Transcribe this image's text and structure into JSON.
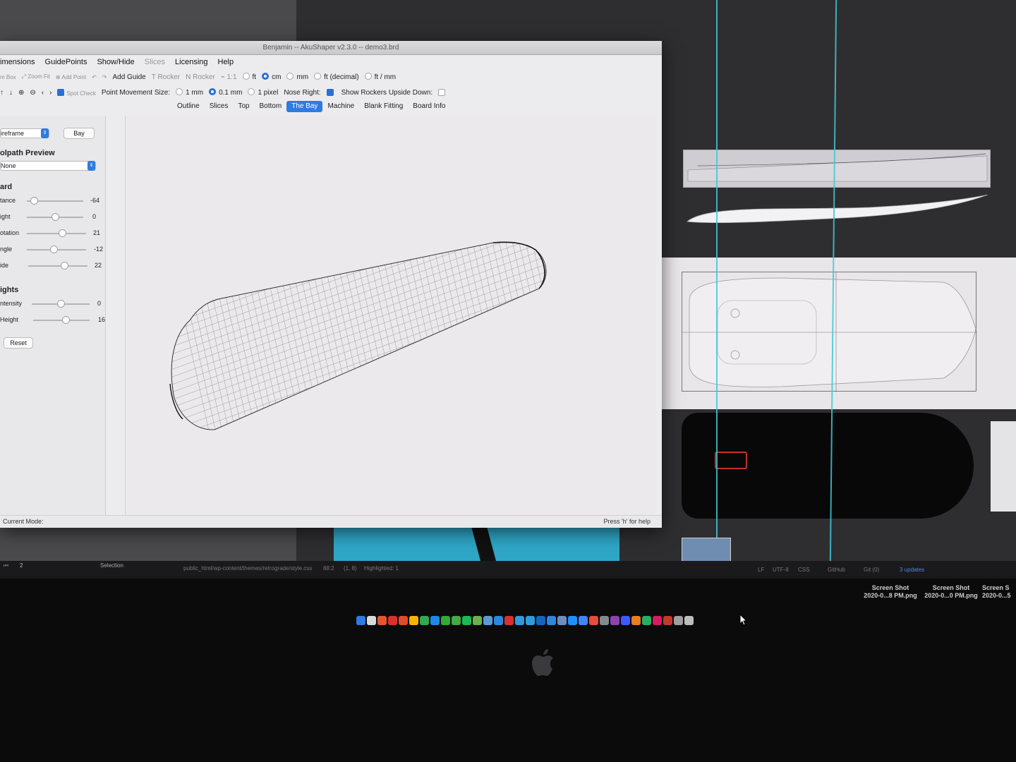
{
  "window": {
    "title": "Benjamin -- AkuShaper v2.3.0  --  demo3.brd"
  },
  "menu": [
    {
      "label": "imensions",
      "disabled": false
    },
    {
      "label": "GuidePoints",
      "disabled": false
    },
    {
      "label": "Show/Hide",
      "disabled": false
    },
    {
      "label": "Slices",
      "disabled": true
    },
    {
      "label": "Licensing",
      "disabled": false
    },
    {
      "label": "Help",
      "disabled": false
    }
  ],
  "toolbar1": {
    "zoom_box": "m Box",
    "zoom_fit": "Zoom Fit",
    "add_point": "Add Point",
    "add_guide": "Add Guide",
    "t_rocker": "T Rocker",
    "n_rocker": "N Rocker",
    "scale": "1:1",
    "units": [
      {
        "label": "ft",
        "selected": false
      },
      {
        "label": "cm",
        "selected": true
      },
      {
        "label": "mm",
        "selected": false
      },
      {
        "label": "ft (decimal)",
        "selected": false
      },
      {
        "label": "ft / mm",
        "selected": false
      }
    ]
  },
  "toolbar2": {
    "spot_check": "Spot Check",
    "spot_check_on": true,
    "point_movement_label": "Point Movement Size:",
    "movement": [
      {
        "label": "1 mm",
        "selected": false
      },
      {
        "label": "0.1 mm",
        "selected": true
      },
      {
        "label": "1 pixel",
        "selected": false
      }
    ],
    "nose_right": "Nose Right:",
    "nose_right_on": true,
    "rockers_upside": "Show Rockers Upside Down:",
    "rockers_upside_on": false
  },
  "tabs": [
    {
      "label": "Outline",
      "active": false
    },
    {
      "label": "Slices",
      "active": false
    },
    {
      "label": "Top",
      "active": false
    },
    {
      "label": "Bottom",
      "active": false
    },
    {
      "label": "The Bay",
      "active": true
    },
    {
      "label": "Machine",
      "active": false
    },
    {
      "label": "Blank Fitting",
      "active": false
    },
    {
      "label": "Board Info",
      "active": false
    }
  ],
  "sidebar": {
    "render_mode": "ireframe",
    "bay_button": "Bay",
    "toolpath_title": "olpath Preview",
    "toolpath_value": "None",
    "board_title": "ard",
    "board_sliders": [
      {
        "label": "tance",
        "value": "-64",
        "level": 0.12
      },
      {
        "label": "ight",
        "value": "0",
        "level": 0.5
      },
      {
        "label": "otation",
        "value": "21",
        "level": 0.6
      },
      {
        "label": "ngle",
        "value": "-12",
        "level": 0.45
      },
      {
        "label": "ide",
        "value": "22",
        "level": 0.61
      }
    ],
    "lights_title": "ights",
    "light_sliders": [
      {
        "label": "ntensity",
        "value": "0",
        "level": 0.5
      },
      {
        "label": "Height",
        "value": "16",
        "level": 0.58
      }
    ],
    "reset": "Reset"
  },
  "status": {
    "mode": "Current Mode:",
    "help": "Press 'h' for help"
  },
  "ide": {
    "page": "2",
    "selection": "Selection",
    "path": "public_html/wp-content/themes/retrograde/style.css",
    "pos": "88:2",
    "sel": "(1, 8)",
    "highlighted": "Highlighted: 1",
    "lf": "LF",
    "enc": "UTF-8",
    "lang": "CSS",
    "git": "GitHub",
    "gitcount": "Git (0)",
    "updates": "3 updates"
  },
  "desktop_files": [
    {
      "name": "Screen Shot",
      "sub": "2020-0...8 PM.png"
    },
    {
      "name": "Screen Shot",
      "sub": "2020-0...0 PM.png"
    },
    {
      "name": "Screen S",
      "sub": "2020-0...5"
    }
  ],
  "dock_colors": [
    "#2f7be0",
    "#d9d9d9",
    "#e4572e",
    "#d8322b",
    "#e04a2e",
    "#f5b400",
    "#34a853",
    "#1e88e5",
    "#3a3",
    "#44aa44",
    "#1db954",
    "#6ab04c",
    "#5a9bd4",
    "#2e86de",
    "#d63031",
    "#3498db",
    "#2d9cdb",
    "#1565c0",
    "#2e86de",
    "#6c8ebf",
    "#1e90ff",
    "#4285f4",
    "#e74c3c",
    "#7f8c8d",
    "#8e44ad",
    "#3d5afe",
    "#e67e22",
    "#27ae60",
    "#d81b60",
    "#c0392b",
    "#9e9e9e",
    "#bdbdbd"
  ],
  "colors": {
    "accent": "#2f7be0",
    "guide": "#3fc8d4"
  }
}
